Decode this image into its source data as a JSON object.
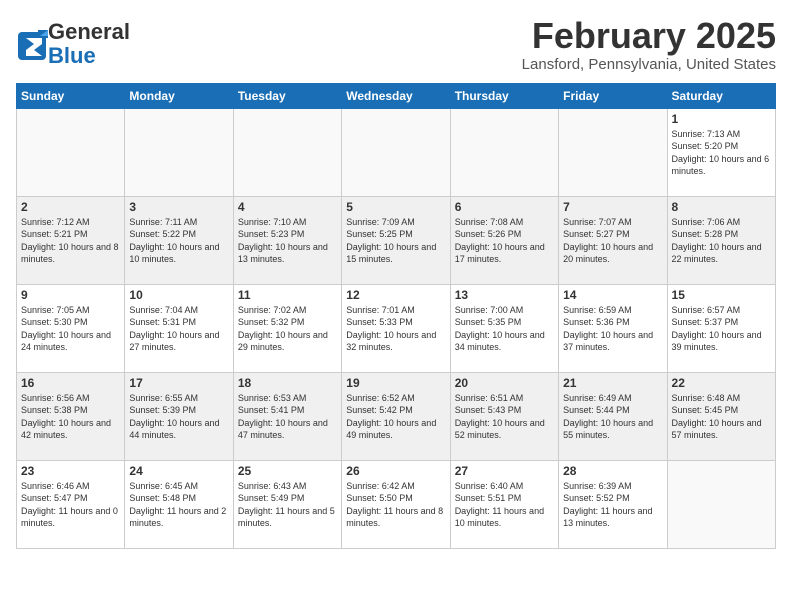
{
  "header": {
    "logo_general": "General",
    "logo_blue": "Blue",
    "title": "February 2025",
    "location": "Lansford, Pennsylvania, United States"
  },
  "weekdays": [
    "Sunday",
    "Monday",
    "Tuesday",
    "Wednesday",
    "Thursday",
    "Friday",
    "Saturday"
  ],
  "weeks": [
    [
      {
        "day": "",
        "info": ""
      },
      {
        "day": "",
        "info": ""
      },
      {
        "day": "",
        "info": ""
      },
      {
        "day": "",
        "info": ""
      },
      {
        "day": "",
        "info": ""
      },
      {
        "day": "",
        "info": ""
      },
      {
        "day": "1",
        "info": "Sunrise: 7:13 AM\nSunset: 5:20 PM\nDaylight: 10 hours\nand 6 minutes."
      }
    ],
    [
      {
        "day": "2",
        "info": "Sunrise: 7:12 AM\nSunset: 5:21 PM\nDaylight: 10 hours\nand 8 minutes."
      },
      {
        "day": "3",
        "info": "Sunrise: 7:11 AM\nSunset: 5:22 PM\nDaylight: 10 hours\nand 10 minutes."
      },
      {
        "day": "4",
        "info": "Sunrise: 7:10 AM\nSunset: 5:23 PM\nDaylight: 10 hours\nand 13 minutes."
      },
      {
        "day": "5",
        "info": "Sunrise: 7:09 AM\nSunset: 5:25 PM\nDaylight: 10 hours\nand 15 minutes."
      },
      {
        "day": "6",
        "info": "Sunrise: 7:08 AM\nSunset: 5:26 PM\nDaylight: 10 hours\nand 17 minutes."
      },
      {
        "day": "7",
        "info": "Sunrise: 7:07 AM\nSunset: 5:27 PM\nDaylight: 10 hours\nand 20 minutes."
      },
      {
        "day": "8",
        "info": "Sunrise: 7:06 AM\nSunset: 5:28 PM\nDaylight: 10 hours\nand 22 minutes."
      }
    ],
    [
      {
        "day": "9",
        "info": "Sunrise: 7:05 AM\nSunset: 5:30 PM\nDaylight: 10 hours\nand 24 minutes."
      },
      {
        "day": "10",
        "info": "Sunrise: 7:04 AM\nSunset: 5:31 PM\nDaylight: 10 hours\nand 27 minutes."
      },
      {
        "day": "11",
        "info": "Sunrise: 7:02 AM\nSunset: 5:32 PM\nDaylight: 10 hours\nand 29 minutes."
      },
      {
        "day": "12",
        "info": "Sunrise: 7:01 AM\nSunset: 5:33 PM\nDaylight: 10 hours\nand 32 minutes."
      },
      {
        "day": "13",
        "info": "Sunrise: 7:00 AM\nSunset: 5:35 PM\nDaylight: 10 hours\nand 34 minutes."
      },
      {
        "day": "14",
        "info": "Sunrise: 6:59 AM\nSunset: 5:36 PM\nDaylight: 10 hours\nand 37 minutes."
      },
      {
        "day": "15",
        "info": "Sunrise: 6:57 AM\nSunset: 5:37 PM\nDaylight: 10 hours\nand 39 minutes."
      }
    ],
    [
      {
        "day": "16",
        "info": "Sunrise: 6:56 AM\nSunset: 5:38 PM\nDaylight: 10 hours\nand 42 minutes."
      },
      {
        "day": "17",
        "info": "Sunrise: 6:55 AM\nSunset: 5:39 PM\nDaylight: 10 hours\nand 44 minutes."
      },
      {
        "day": "18",
        "info": "Sunrise: 6:53 AM\nSunset: 5:41 PM\nDaylight: 10 hours\nand 47 minutes."
      },
      {
        "day": "19",
        "info": "Sunrise: 6:52 AM\nSunset: 5:42 PM\nDaylight: 10 hours\nand 49 minutes."
      },
      {
        "day": "20",
        "info": "Sunrise: 6:51 AM\nSunset: 5:43 PM\nDaylight: 10 hours\nand 52 minutes."
      },
      {
        "day": "21",
        "info": "Sunrise: 6:49 AM\nSunset: 5:44 PM\nDaylight: 10 hours\nand 55 minutes."
      },
      {
        "day": "22",
        "info": "Sunrise: 6:48 AM\nSunset: 5:45 PM\nDaylight: 10 hours\nand 57 minutes."
      }
    ],
    [
      {
        "day": "23",
        "info": "Sunrise: 6:46 AM\nSunset: 5:47 PM\nDaylight: 11 hours\nand 0 minutes."
      },
      {
        "day": "24",
        "info": "Sunrise: 6:45 AM\nSunset: 5:48 PM\nDaylight: 11 hours\nand 2 minutes."
      },
      {
        "day": "25",
        "info": "Sunrise: 6:43 AM\nSunset: 5:49 PM\nDaylight: 11 hours\nand 5 minutes."
      },
      {
        "day": "26",
        "info": "Sunrise: 6:42 AM\nSunset: 5:50 PM\nDaylight: 11 hours\nand 8 minutes."
      },
      {
        "day": "27",
        "info": "Sunrise: 6:40 AM\nSunset: 5:51 PM\nDaylight: 11 hours\nand 10 minutes."
      },
      {
        "day": "28",
        "info": "Sunrise: 6:39 AM\nSunset: 5:52 PM\nDaylight: 11 hours\nand 13 minutes."
      },
      {
        "day": "",
        "info": ""
      }
    ]
  ]
}
